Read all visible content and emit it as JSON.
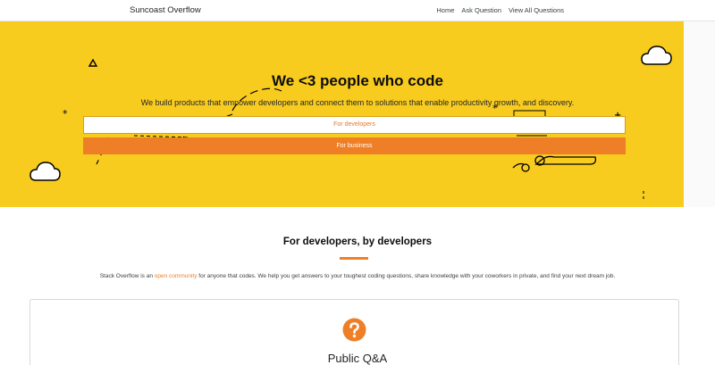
{
  "navbar": {
    "brand": "Suncoast Overflow",
    "links": [
      "Home",
      "Ask Question",
      "View All Questions"
    ]
  },
  "hero": {
    "title": "We <3 people who code",
    "subtitle": "We build products that empower developers and connect them to solutions that enable productivity growth, and discovery.",
    "button_developers": "For developers",
    "button_business": "For business"
  },
  "section": {
    "title": "For developers, by developers",
    "text_before": "Stack Overflow is an ",
    "text_link": "open community",
    "text_after": " for anyone that codes. We help you get answers to your toughest coding questions, share knowledge with your coworkers in private, and find your next dream job."
  },
  "card": {
    "icon": "question-circle-icon",
    "title": "Public Q&A"
  },
  "colors": {
    "hero_bg": "#f8cb1f",
    "accent": "#ef7f27",
    "text": "#232629"
  }
}
